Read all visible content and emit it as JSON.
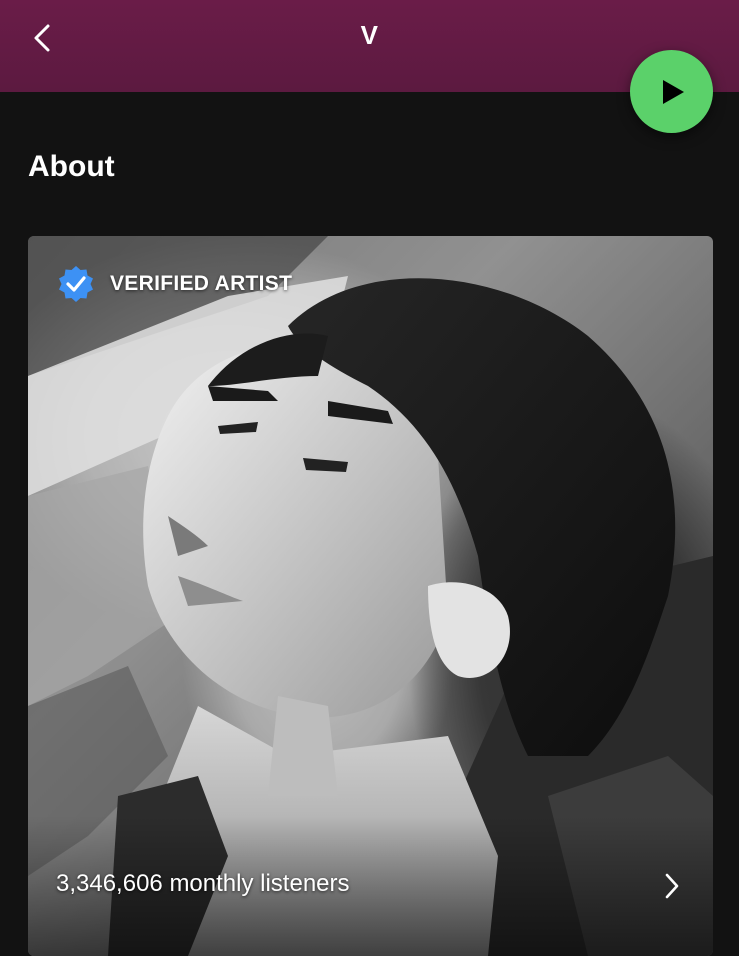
{
  "header": {
    "back_icon": "chevron-left-icon",
    "title": "V",
    "play_icon": "play-icon",
    "background_color": "#6a1c48",
    "play_color": "#5bd16a"
  },
  "about": {
    "section_title": "About",
    "verified_icon": "verified-badge-icon",
    "verified_label": "VERIFIED ARTIST",
    "verified_color": "#3d91f4",
    "listeners_text": "3,346,606 monthly listeners",
    "chevron_icon": "chevron-right-icon"
  }
}
